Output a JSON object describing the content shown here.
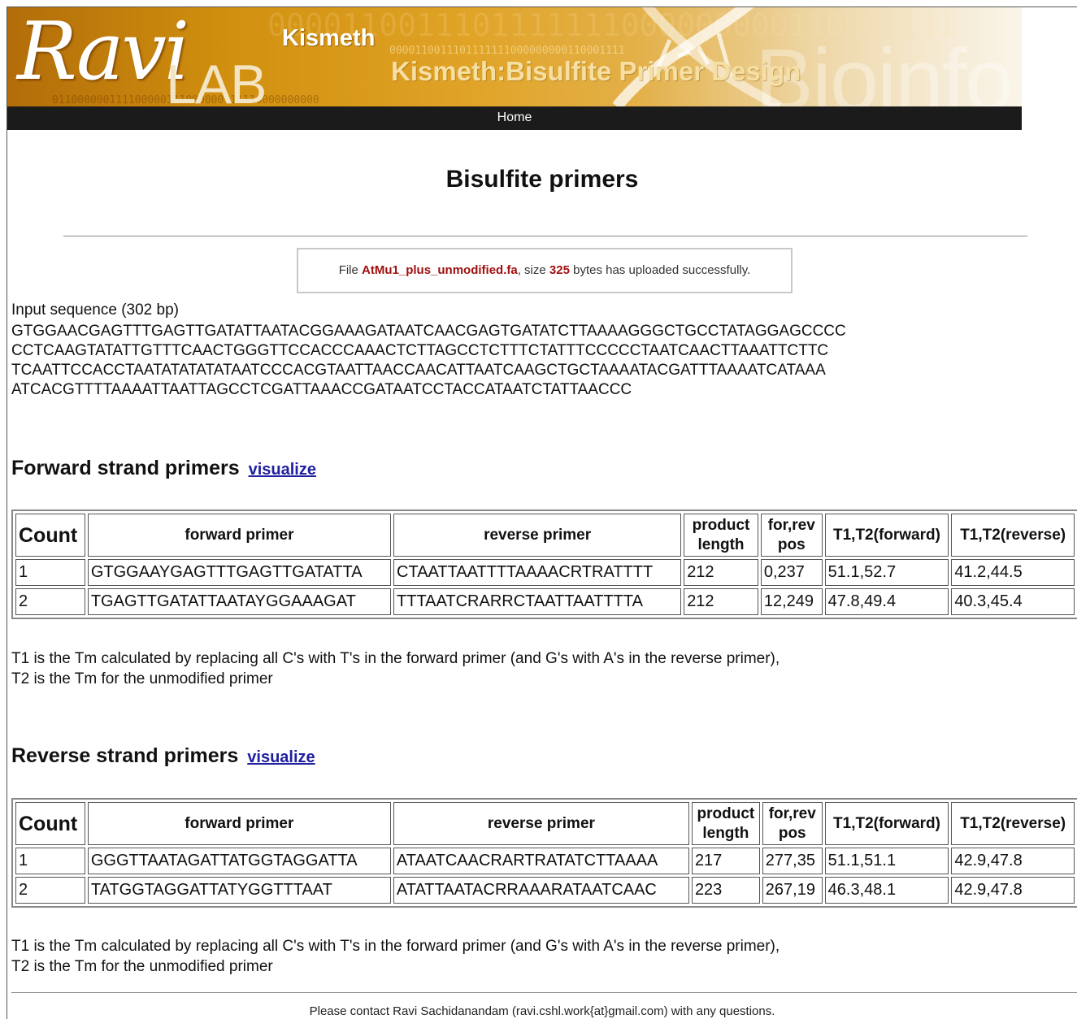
{
  "header": {
    "logo_script": "Ravi",
    "logo_lab": "LAB",
    "app_name": "Kismeth",
    "subtitle": "Kismeth:Bisulfite Primer Design",
    "watermark": "Bioinfo",
    "binary_top": "0000110011101111111000000000110001111",
    "binary_bottom": "011000000111100000111000000111110000000000"
  },
  "nav": {
    "home_label": "Home"
  },
  "page": {
    "title": "Bisulfite primers",
    "upload": {
      "prefix": "File ",
      "filename": "AtMu1_plus_unmodified.fa",
      "middle": ", size ",
      "size": "325",
      "suffix": " bytes has uploaded successfully."
    },
    "input_label": "Input sequence (302 bp)",
    "sequence_lines": [
      "GTGGAACGAGTTTGAGTTGATATTAATACGGAAAGATAATCAACGAGTGATATCTTAAAAGGGCTGCCTATAGGAGCCCC",
      "CCTCAAGTATATTGTTTCAACTGGGTTCCACCCAAACTCTTAGCCTCTTTCTATTTCCCCCTAATCAACTTAAATTCTTC",
      "TCAATTCCACCTAATATATATATAATCCCACGTAATTAACCAACATTAATCAAGCTGCTAAAATACGATTTAAAATCATAAA",
      "ATCACGTTTTAAAATTAATTAGCCTCGATTAAACCGATAATCCTACCATAATCTATTAACCC"
    ]
  },
  "forward": {
    "heading": "Forward strand primers",
    "link": "visualize",
    "headers": [
      "Count",
      "forward primer",
      "reverse primer",
      "product length",
      "for,rev pos",
      "T1,T2(forward)",
      "T1,T2(reverse)"
    ],
    "rows": [
      [
        "1",
        "GTGGAAYGAGTTTGAGTTGATATTA",
        "CTAATTAATTTTAAAACRTRATTTT",
        "212",
        "0,237",
        "51.1,52.7",
        "41.2,44.5"
      ],
      [
        "2",
        "TGAGTTGATATTAATAYGGAAAGAT",
        "TTTAATCRARRCTAATTAATTTTA",
        "212",
        "12,249",
        "47.8,49.4",
        "40.3,45.4"
      ]
    ],
    "note_1": "T1 is the Tm calculated by replacing all C's with T's in the forward primer (and G's with A's in the reverse primer),",
    "note_2": "T2 is the Tm for the unmodified primer"
  },
  "reverse": {
    "heading": "Reverse strand primers",
    "link": "visualize",
    "headers": [
      "Count",
      "forward primer",
      "reverse primer",
      "product length",
      "for,rev pos",
      "T1,T2(forward)",
      "T1,T2(reverse)"
    ],
    "rows": [
      [
        "1",
        "GGGTTAATAGATTATGGTAGGATTA",
        "ATAATCAACRARTRATATCTTAAAA",
        "217",
        "277,35",
        "51.1,51.1",
        "42.9,47.8"
      ],
      [
        "2",
        "TATGGTAGGATTATYGGTTTAAT",
        "ATATTAATACRRAAARATAATCAAC",
        "223",
        "267,19",
        "46.3,48.1",
        "42.9,47.8"
      ]
    ],
    "note_1": "T1 is the Tm calculated by replacing all C's with T's in the forward primer (and G's with A's in the reverse primer),",
    "note_2": "T2 is the Tm for the unmodified primer"
  },
  "footer": {
    "contact": "Please contact Ravi Sachidanandam (ravi.cshl.work{at}gmail.com) with any questions."
  },
  "colors": {
    "banner_start": "#b26d09",
    "banner_end": "#faf5ea",
    "navbar": "#1b1b1b",
    "highlight": "#a01010",
    "link": "#2020a0"
  }
}
